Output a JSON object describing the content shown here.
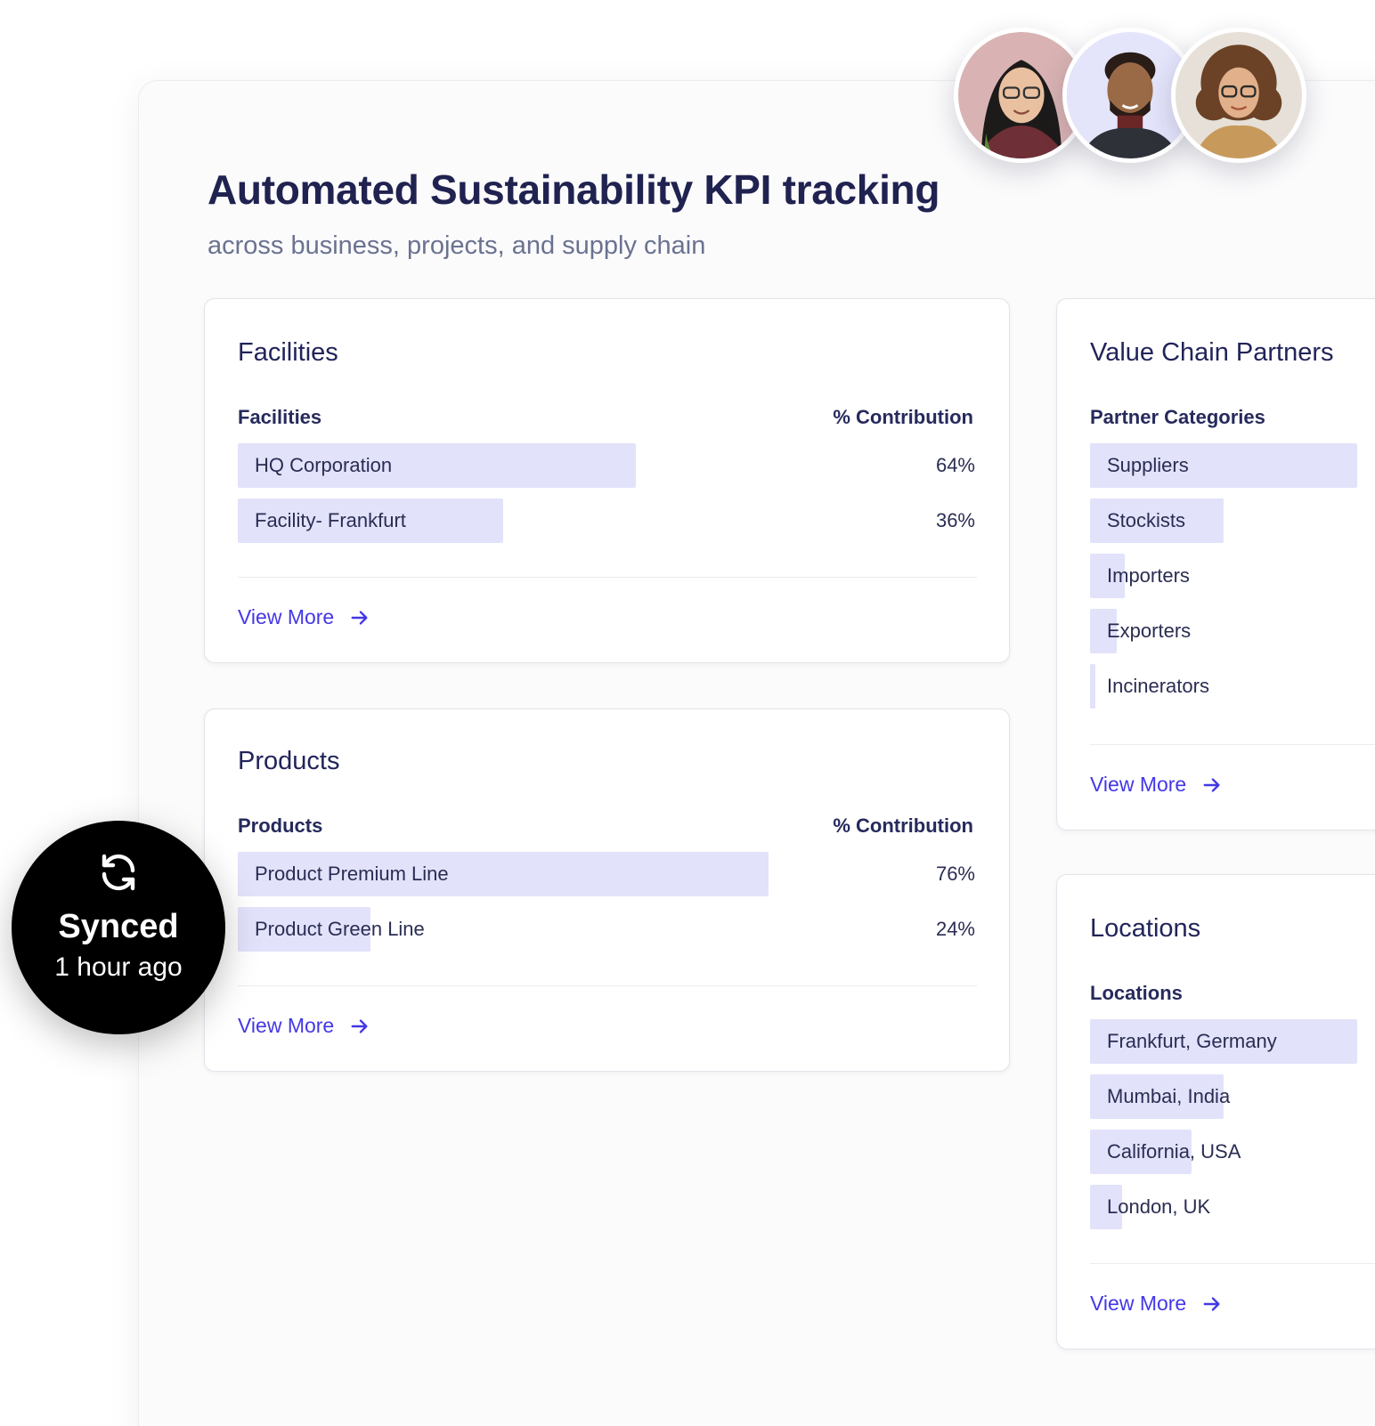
{
  "headline": "Automated Sustainability KPI tracking",
  "subheadline": "across business, projects, and supply chain",
  "facilities_card": {
    "title": "Facilities",
    "column_name": "Facilities",
    "column_value": "% Contribution",
    "rows": [
      {
        "label": "HQ Corporation",
        "value": "64%",
        "fraction": 0.54
      },
      {
        "label": "Facility- Frankfurt",
        "value": "36%",
        "fraction": 0.36
      }
    ],
    "view_more": "View More"
  },
  "products_card": {
    "title": "Products",
    "column_name": "Products",
    "column_value": "% Contribution",
    "rows": [
      {
        "label": "Product Premium Line",
        "value": "76%",
        "fraction": 0.72
      },
      {
        "label": "Product Green Line",
        "value": "24%",
        "fraction": 0.18
      }
    ],
    "view_more": "View More"
  },
  "partners_card": {
    "title": "Value Chain Partners",
    "column_name": "Partner Categories",
    "rows": [
      {
        "label": "Suppliers",
        "fraction": 1.0
      },
      {
        "label": "Stockists",
        "fraction": 0.5
      },
      {
        "label": "Importers",
        "fraction": 0.13
      },
      {
        "label": "Exporters",
        "fraction": 0.1
      },
      {
        "label": "Incinerators",
        "fraction": 0.02
      }
    ],
    "view_more": "View More"
  },
  "locations_card": {
    "title": "Locations",
    "column_name": "Locations",
    "rows": [
      {
        "label": "Frankfurt, Germany",
        "fraction": 1.0
      },
      {
        "label": "Mumbai, India",
        "fraction": 0.5
      },
      {
        "label": "California, USA",
        "fraction": 0.38
      },
      {
        "label": "London, UK",
        "fraction": 0.12
      }
    ],
    "view_more": "View More"
  },
  "synced_badge": {
    "title": "Synced",
    "time": "1 hour ago",
    "icon": "sync-icon"
  },
  "avatars": [
    {
      "icon": "avatar-woman-glasses"
    },
    {
      "icon": "avatar-man-beard"
    },
    {
      "icon": "avatar-woman-curly"
    }
  ],
  "colors": {
    "accent": "#4338e6",
    "bar": "#e2e2fb",
    "heading": "#202250",
    "subheading": "#6b7290"
  }
}
